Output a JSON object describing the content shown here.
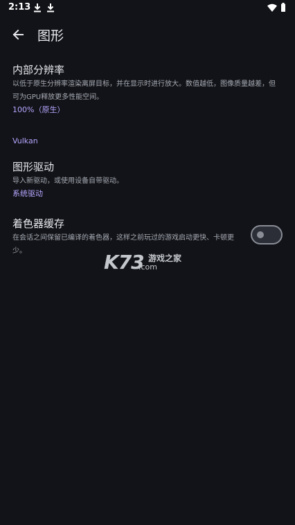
{
  "status_bar": {
    "time": "2:13",
    "icons": [
      "download-icon",
      "download-icon",
      "wifi-icon",
      "battery-icon"
    ]
  },
  "header": {
    "back_icon": "arrow-left-icon",
    "title": "图形"
  },
  "settings": {
    "resolution": {
      "title": "内部分辨率",
      "description": "以低于原生分辨率渲染离屏目标，并在显示时进行放大。数值越低，图像质量越差，但可为GPU释放更多性能空间。",
      "value": "100%（原生）"
    },
    "section": "Vulkan",
    "driver": {
      "title": "图形驱动",
      "description": "导入新驱动，或使用设备自带驱动。",
      "value": "系统驱动"
    },
    "shader_cache": {
      "title": "着色器缓存",
      "description": "在会话之间保留已编译的着色器，这样之前玩过的游戏启动更快、卡顿更少。",
      "enabled": false
    }
  },
  "watermark": {
    "logo": "K73",
    "site": "游戏之家",
    "domain": ".com"
  },
  "colors": {
    "background": "#111318",
    "accent": "#b7a6ff",
    "text_primary": "#e8e8ee",
    "text_secondary": "#a9abb4"
  }
}
